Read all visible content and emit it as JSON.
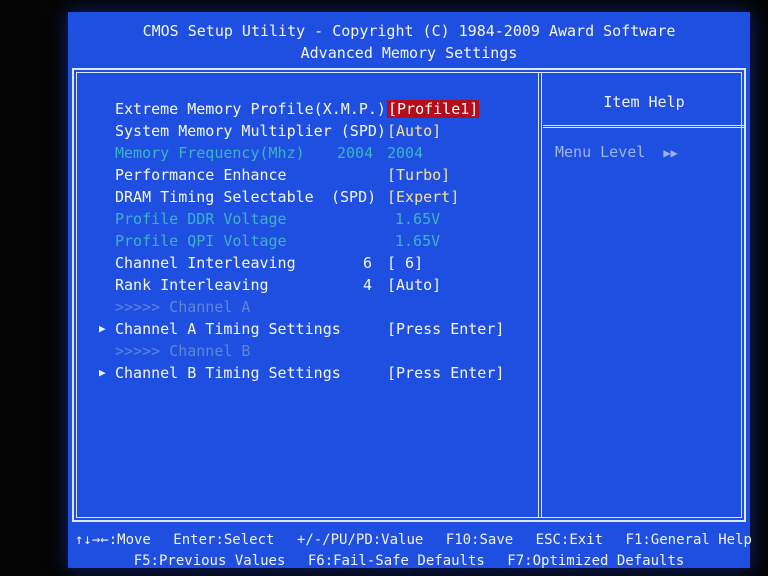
{
  "header": {
    "line1": "CMOS Setup Utility - Copyright (C) 1984-2009 Award Software",
    "line2": "Advanced Memory Settings"
  },
  "settings": [
    {
      "label": "Extreme Memory Profile(X.M.P.)",
      "source": "",
      "value": "[Profile1]",
      "state": "selected"
    },
    {
      "label": "System Memory Multiplier (SPD)",
      "source": "",
      "value": "[Auto]",
      "state": "editable"
    },
    {
      "label": "Memory Frequency(Mhz)",
      "source": "2004",
      "value": "2004",
      "state": "disabled"
    },
    {
      "label": "Performance Enhance",
      "source": "",
      "value": "[Turbo]",
      "state": "editable"
    },
    {
      "label": "DRAM Timing Selectable",
      "source": "(SPD)",
      "value": "[Expert]",
      "state": "editable"
    },
    {
      "label": "Profile DDR Voltage",
      "source": "",
      "value": "1.65V",
      "state": "disabled"
    },
    {
      "label": "Profile QPI Voltage",
      "source": "",
      "value": "1.65V",
      "state": "disabled"
    },
    {
      "label": "Channel Interleaving",
      "source": "6",
      "value": "[  6]",
      "state": "editable"
    },
    {
      "label": "Rank Interleaving",
      "source": "4",
      "value": "[Auto]",
      "state": "editable"
    },
    {
      "label": ">>>>> Channel A",
      "source": "",
      "value": "",
      "state": "section"
    },
    {
      "label": "Channel A Timing Settings",
      "source": "",
      "value": "[Press Enter]",
      "state": "submenu"
    },
    {
      "label": ">>>>> Channel B",
      "source": "",
      "value": "",
      "state": "section"
    },
    {
      "label": "Channel B Timing Settings",
      "source": "",
      "value": "[Press Enter]",
      "state": "submenu"
    }
  ],
  "help_panel": {
    "title": "Item Help",
    "menu_level_label": "Menu Level",
    "menu_level_arrows": "▶▶"
  },
  "footer": {
    "line1": [
      "↑↓→←:Move",
      "Enter:Select",
      "+/-/PU/PD:Value",
      "F10:Save",
      "ESC:Exit",
      "F1:General Help"
    ],
    "line2": [
      "F5:Previous Values",
      "F6:Fail-Safe Defaults",
      "F7:Optimized Defaults"
    ]
  },
  "colors": {
    "background": "#1f4fe0",
    "text": "#f4f6ff",
    "value": "#f3e39b",
    "disabled": "#3bb3c8",
    "highlight": "#b50d1a"
  }
}
